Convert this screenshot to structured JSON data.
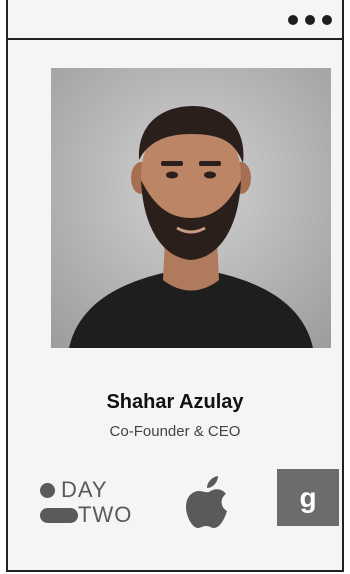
{
  "window": {
    "menu_icon": "more-dots-icon"
  },
  "profile": {
    "name": "Shahar Azulay",
    "role": "Co-Founder & CEO",
    "photo_alt": "Portrait of Shahar Azulay"
  },
  "logos": {
    "daytwo": {
      "line1": "DAY",
      "line2": "TWO"
    },
    "apple": {
      "icon": "apple-logo-icon"
    },
    "g": {
      "letter": "g"
    }
  },
  "colors": {
    "frame": "#222222",
    "background": "#f6f5f3",
    "logo_gray": "#5a5a5a"
  }
}
